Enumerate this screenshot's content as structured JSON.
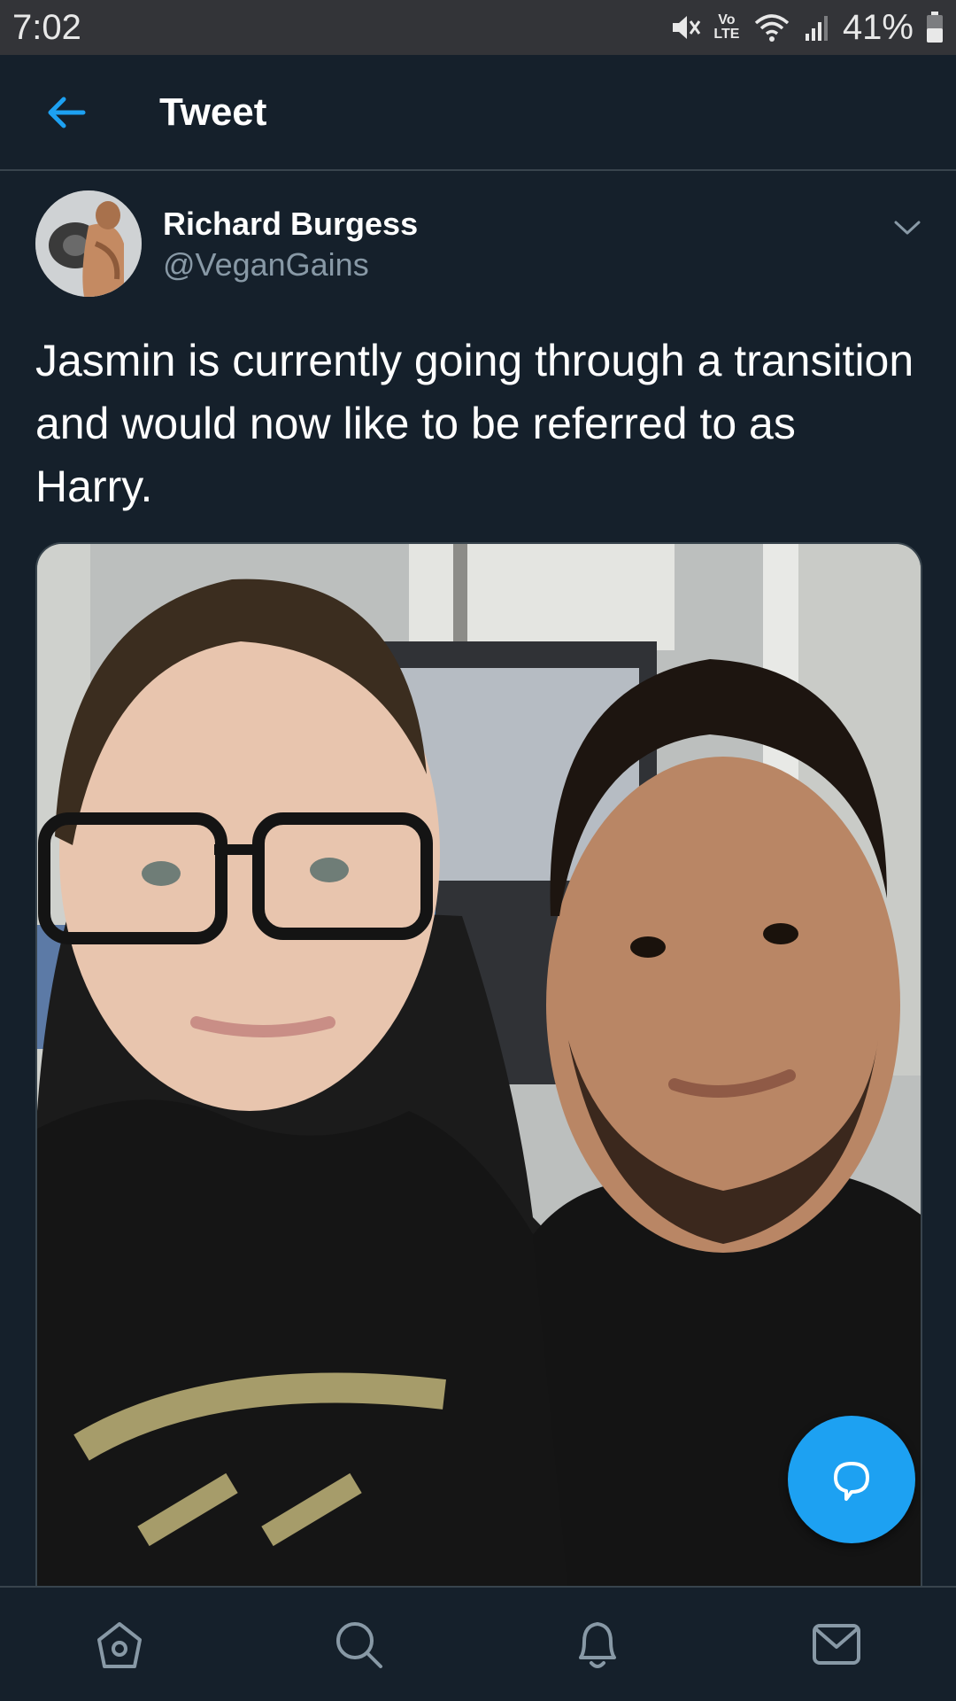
{
  "status_bar": {
    "time": "7:02",
    "network_label": "Vo LTE",
    "battery_text": "41%"
  },
  "header": {
    "title": "Tweet"
  },
  "tweet": {
    "author_name": "Richard Burgess",
    "author_handle": "@VeganGains",
    "text": "Jasmin is currently going through a transition and would now like to be referred to as Harry."
  },
  "bottom_nav": {
    "items": [
      {
        "icon": "home-icon"
      },
      {
        "icon": "search-icon"
      },
      {
        "icon": "notifications-icon"
      },
      {
        "icon": "messages-icon"
      }
    ]
  },
  "colors": {
    "background": "#15202b",
    "accent": "#1da1f2",
    "secondary_text": "#8899a6",
    "divider": "#38444d"
  }
}
